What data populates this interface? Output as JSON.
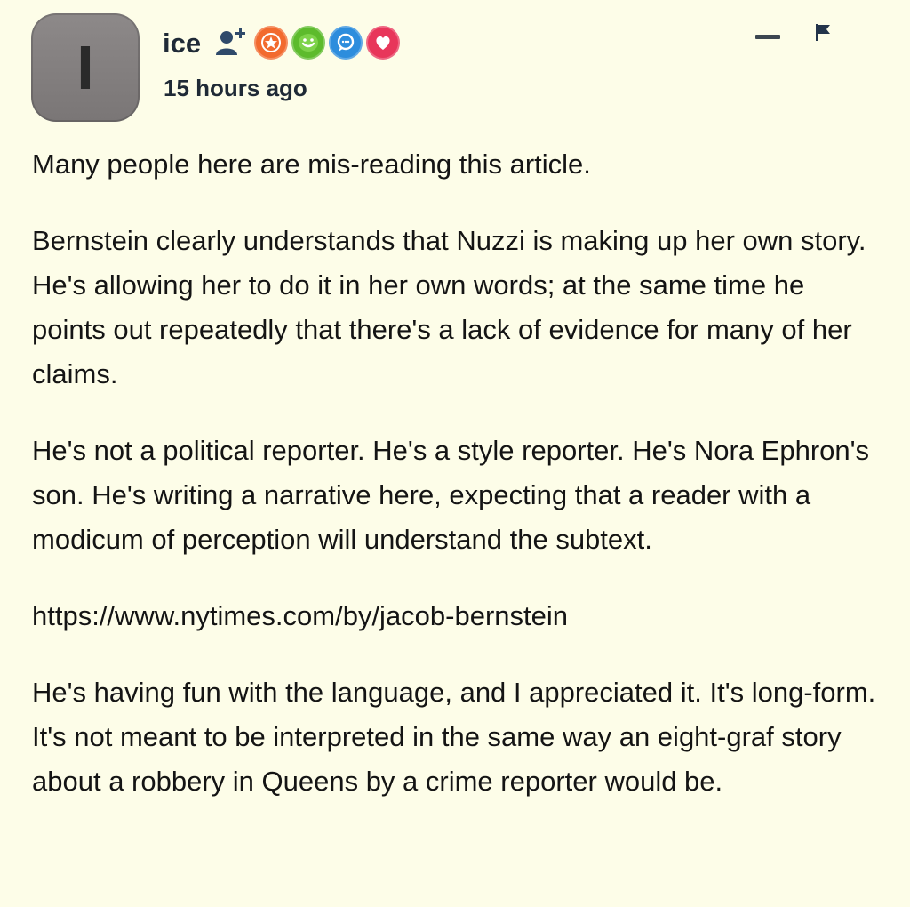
{
  "comment": {
    "avatar_letter": "I",
    "username": "ice",
    "timestamp": "15 hours ago",
    "badges": [
      {
        "name": "star-badge-icon",
        "color": "#f26a2e"
      },
      {
        "name": "smile-badge-icon",
        "color": "#5dbb2c"
      },
      {
        "name": "chat-badge-icon",
        "color": "#2d8ddd"
      },
      {
        "name": "heart-badge-icon",
        "color": "#e8365a"
      }
    ],
    "paragraphs": [
      "Many people here are mis-reading this article.",
      "Bernstein clearly understands that Nuzzi is making up her own story. He's allowing her to do it in her own words; at the same time he points out repeatedly that there's a lack of evidence for many of her claims.",
      "He's not a political reporter. He's a style reporter. He's Nora Ephron's son. He's writing a narrative here, expecting that a reader with a modicum of perception will understand the subtext."
    ],
    "link": "https://www.nytimes.com/by/jacob-bernstein",
    "closing_paragraph": "He's having fun with the language, and I appreciated it. It's long-form. It's not meant to be interpreted in the same way an eight-graf story about a robbery in Queens by a crime reporter would be."
  },
  "colors": {
    "background": "#fdfde8",
    "text": "#141414",
    "username": "#1f2a36"
  }
}
